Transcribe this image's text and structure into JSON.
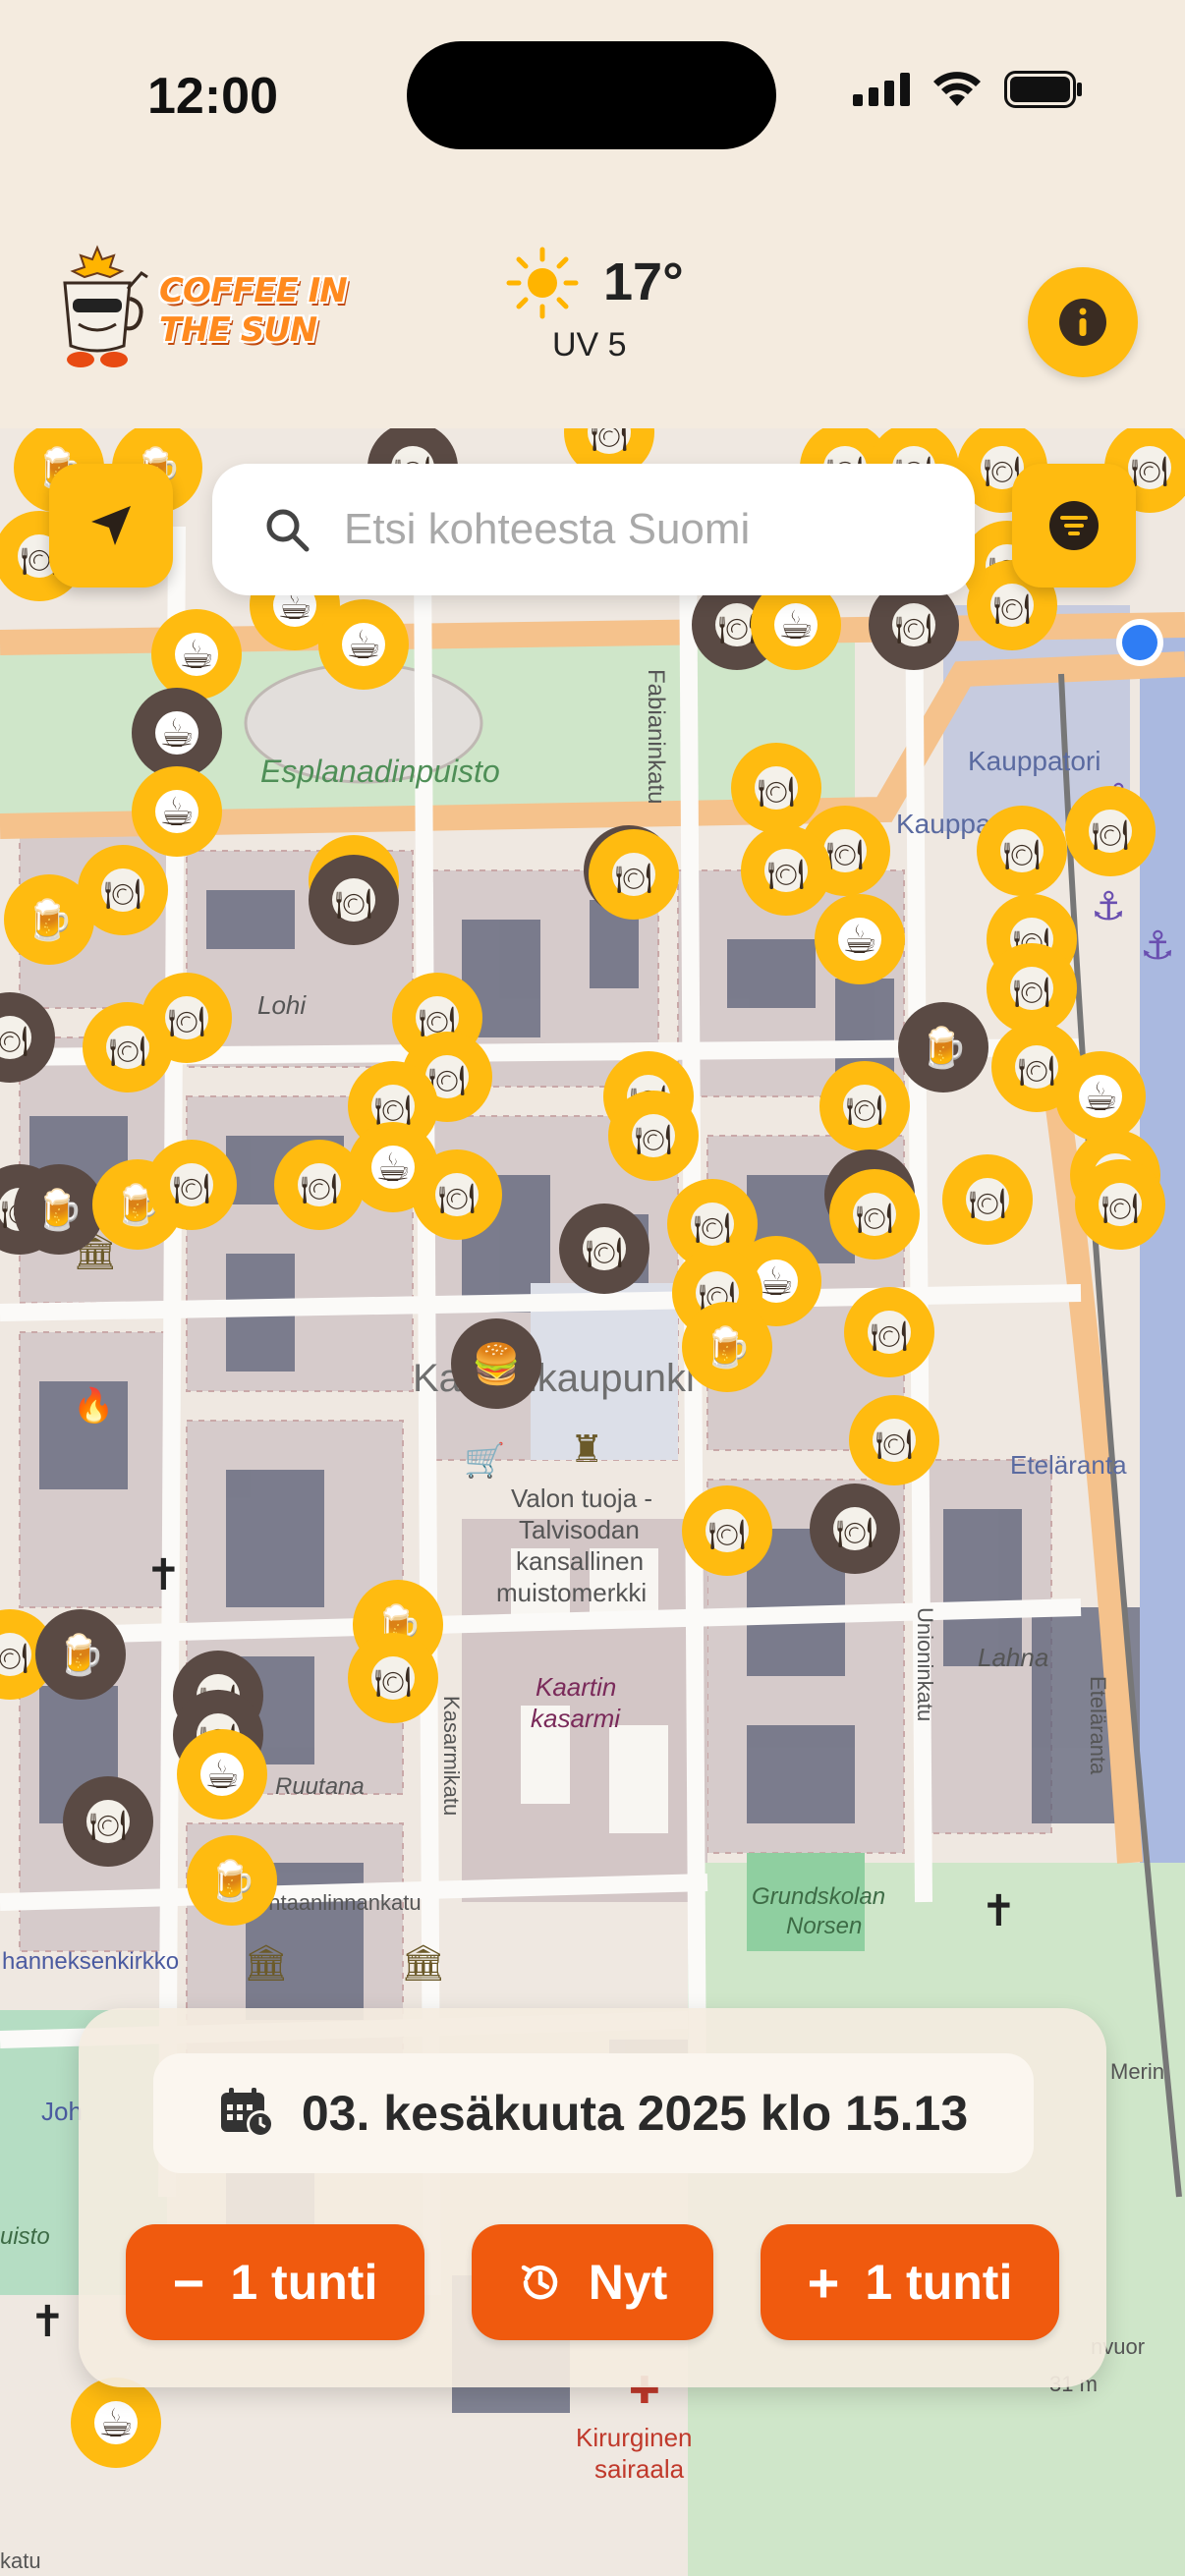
{
  "status_bar": {
    "time": "12:00"
  },
  "header": {
    "logo_line1": "COFFEE IN",
    "logo_line2": "THE SUN",
    "temperature": "17°",
    "uv": "UV 5"
  },
  "search": {
    "placeholder": "Etsi kohteesta Suomi"
  },
  "map_labels": {
    "esplanadi": "Esplanadinpuisto",
    "fabianinkatu": "Fabianinkatu",
    "kauppatori": "Kauppatori",
    "kauppa": "Kauppa",
    "lohi": "Lohi",
    "kaartinkaupunki": "Kaartinkaupunki",
    "valon_tuoja_1": "Valon tuoja -",
    "valon_tuoja_2": "Talvisodan",
    "valon_tuoja_3": "kansallinen",
    "valon_tuoja_4": "muistomerkki",
    "kaartin_1": "Kaartin",
    "kaartin_2": "kasarmi",
    "kasarmikatu": "Kasarmikatu",
    "unioninkatu": "Unioninkatu",
    "lahna": "Lahna",
    "etelaranta": "Eteläranta",
    "etelaranta_v": "Eteläranta",
    "ruutana": "Ruutana",
    "annankatu": "Tehtaanlinnankatu",
    "johanneksenkirkko": "hanneksenkirkko",
    "grundskolan_1": "Grundskolan",
    "grundskolan_2": "Norsen",
    "kirurginen_1": "Kirurginen",
    "kirurginen_2": "sairaala",
    "merin": "Merin",
    "vuor": "nvuor",
    "elev": "31 m",
    "jo": "Joh",
    "uisto": "uisto",
    "katu_bl": "katu"
  },
  "time_panel": {
    "datetime": "03. kesäkuuta 2025 klo 15.13",
    "minus_label": "1 tunti",
    "now_label": "Nyt",
    "plus_label": "1 tunti"
  },
  "colors": {
    "accent_yellow": "#ffbb10",
    "accent_orange": "#f05a0e",
    "marker_shade": "#5a4a44",
    "header_bg": "#f4ebdf"
  }
}
